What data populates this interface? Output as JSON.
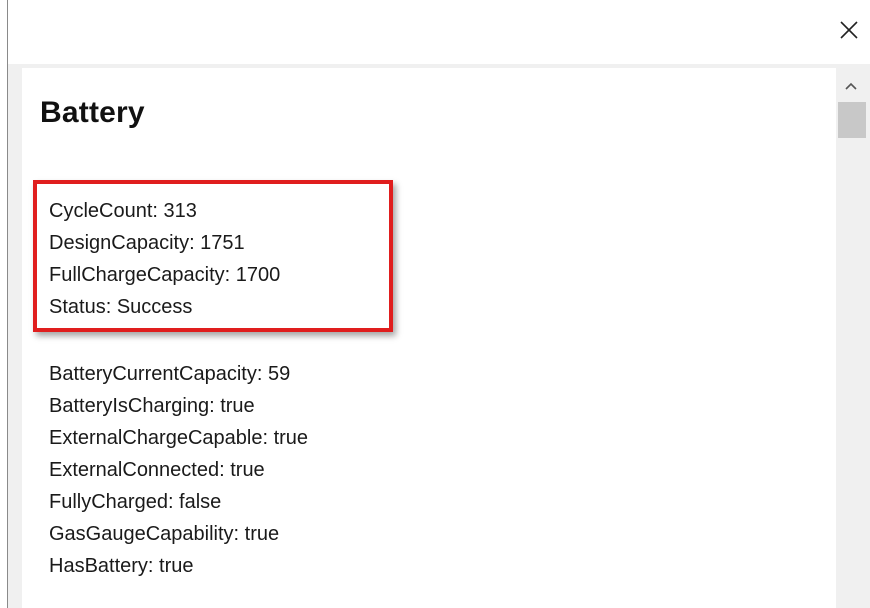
{
  "window": {
    "close_icon": "close-icon"
  },
  "panel": {
    "title": "Battery",
    "highlighted_items": [
      "CycleCount: 313",
      "DesignCapacity: 1751",
      "FullChargeCapacity: 1700",
      "Status: Success"
    ],
    "items": [
      "BatteryCurrentCapacity: 59",
      "BatteryIsCharging: true",
      "ExternalChargeCapable: true",
      "ExternalConnected: true",
      "FullyCharged: false",
      "GasGaugeCapability: true",
      "HasBattery: true"
    ]
  },
  "scrollbar": {
    "up_icon": "chevron-up-icon"
  },
  "colors": {
    "highlight_border": "#e01e1e",
    "scroll_thumb": "#c8c8c8"
  }
}
